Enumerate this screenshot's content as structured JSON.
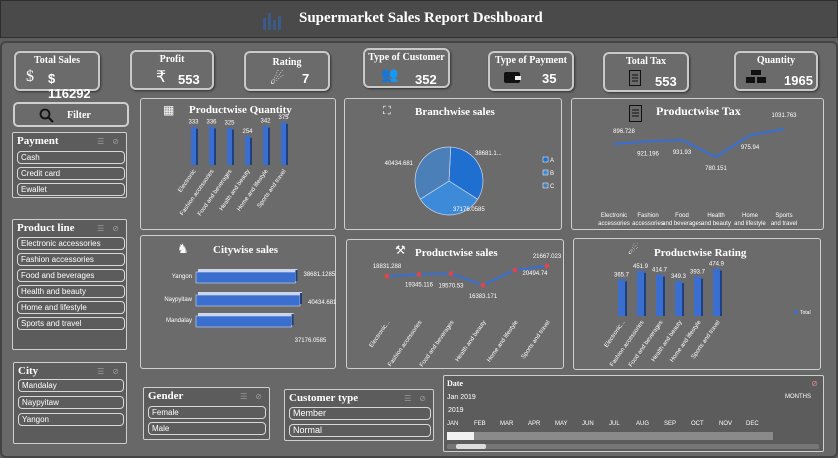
{
  "header": {
    "title": "Supermarket Sales Report Deshboard"
  },
  "kpis": {
    "total_sales": {
      "label": "Total Sales",
      "value": "$ 116292"
    },
    "profit": {
      "label": "Profit",
      "value": "553"
    },
    "rating": {
      "label": "Rating",
      "value": "7"
    },
    "customer_type": {
      "label": "Type of Customer",
      "value": "352"
    },
    "payment_type": {
      "label": "Type of Payment",
      "value": "35"
    },
    "total_tax": {
      "label": "Total Tax",
      "value": "553"
    },
    "quantity": {
      "label": "Quantity",
      "value": "1965"
    }
  },
  "filter": {
    "label": "Filter"
  },
  "slicers": {
    "payment": {
      "title": "Payment",
      "items": [
        "Cash",
        "Credit card",
        "Ewallet"
      ]
    },
    "product_line": {
      "title": "Product line",
      "items": [
        "Electronic accessories",
        "Fashion accessories",
        "Food and beverages",
        "Health and beauty",
        "Home and lifestyle",
        "Sports and travel"
      ]
    },
    "city": {
      "title": "City",
      "items": [
        "Mandalay",
        "Naypyitaw",
        "Yangon"
      ]
    },
    "gender": {
      "title": "Gender",
      "items": [
        "Female",
        "Male"
      ]
    },
    "customer_type": {
      "title": "Customer type",
      "items": [
        "Member",
        "Normal"
      ]
    }
  },
  "timeline": {
    "title": "Date",
    "range": "Jan 2019",
    "year": "2019",
    "granularity": "MONTHS",
    "months": [
      "JAN",
      "FEB",
      "MAR",
      "APR",
      "MAY",
      "JUN",
      "JUL",
      "AUG",
      "SEP",
      "OCT",
      "NOV",
      "DEC"
    ]
  },
  "colors": {
    "bar": "#3a6fd0",
    "line": "#3a6fd0",
    "marker": "#e04545",
    "pie_a": "#1f6fd0",
    "pie_b": "#3c8ad8",
    "pie_c": "#4a7fb8"
  },
  "chart_data": [
    {
      "id": "productwise_quantity",
      "title": "Productwise Quantity",
      "type": "bar",
      "categories": [
        "Electronic",
        "Fashion accessories",
        "Food and beverages",
        "Health and beauty",
        "Home and lifestyle",
        "Sports and travel"
      ],
      "values": [
        333,
        336,
        325,
        254,
        342,
        375
      ],
      "value_labels": [
        "333",
        "336",
        "325",
        "254",
        "342",
        "375"
      ],
      "ylim": [
        0,
        400
      ]
    },
    {
      "id": "branchwise_sales",
      "title": "Branchwise sales",
      "type": "pie",
      "categories": [
        "A",
        "B",
        "C"
      ],
      "values": [
        38681.1285,
        37176.0585,
        40434.681
      ],
      "value_labels": [
        "38681.1...",
        "37176.0585",
        "40434.681"
      ],
      "legend": "right"
    },
    {
      "id": "productwise_tax",
      "title": "Productwise Tax",
      "type": "line",
      "categories": [
        "Electronic accessories",
        "Fashion accessories",
        "Food and beverages",
        "Health and beauty",
        "Home and lifestyle",
        "Sports and travel"
      ],
      "values": [
        896.728,
        921.196,
        931.93,
        780.151,
        975.94,
        1031.763
      ],
      "value_labels": [
        "896.728",
        "921.196",
        "931.93",
        "780.151",
        "975.94",
        "1031.763"
      ]
    },
    {
      "id": "citywise_sales",
      "title": "Citywise sales",
      "type": "bar",
      "orientation": "horizontal",
      "categories": [
        "Yangon",
        "Naypyitaw",
        "Mandalay"
      ],
      "values": [
        38681.1285,
        40434.681,
        37176.0585
      ],
      "value_labels": [
        "38681.1285",
        "40434.681",
        "37176.0585"
      ]
    },
    {
      "id": "productwise_sales",
      "title": "Productwise sales",
      "type": "line",
      "categories": [
        "Electronic...",
        "Fashion accessories",
        "Food and beverages",
        "Health and beauty",
        "Home and lifestyle",
        "Sports and travel"
      ],
      "values": [
        18831.288,
        19345.116,
        19570.53,
        16383.171,
        20494.74,
        21667.023
      ],
      "value_labels": [
        "18831.288",
        "19345.116",
        "19570.53",
        "16383.171",
        "20494.74",
        "21667.023"
      ]
    },
    {
      "id": "productwise_rating",
      "title": "Productwise Rating",
      "type": "bar",
      "categories": [
        "Electronic...",
        "Fashion accessories",
        "Food and beverages",
        "Health and beauty",
        "Home and lifestyle",
        "Sports and travel"
      ],
      "values": [
        365.7,
        451.9,
        414.7,
        349.3,
        393.7,
        474.9
      ],
      "value_labels": [
        "365.7",
        "451.9",
        "414.7",
        "349.3",
        "393.7",
        "474.9"
      ],
      "legend_label": "Total",
      "ylim": [
        0,
        500
      ]
    }
  ]
}
